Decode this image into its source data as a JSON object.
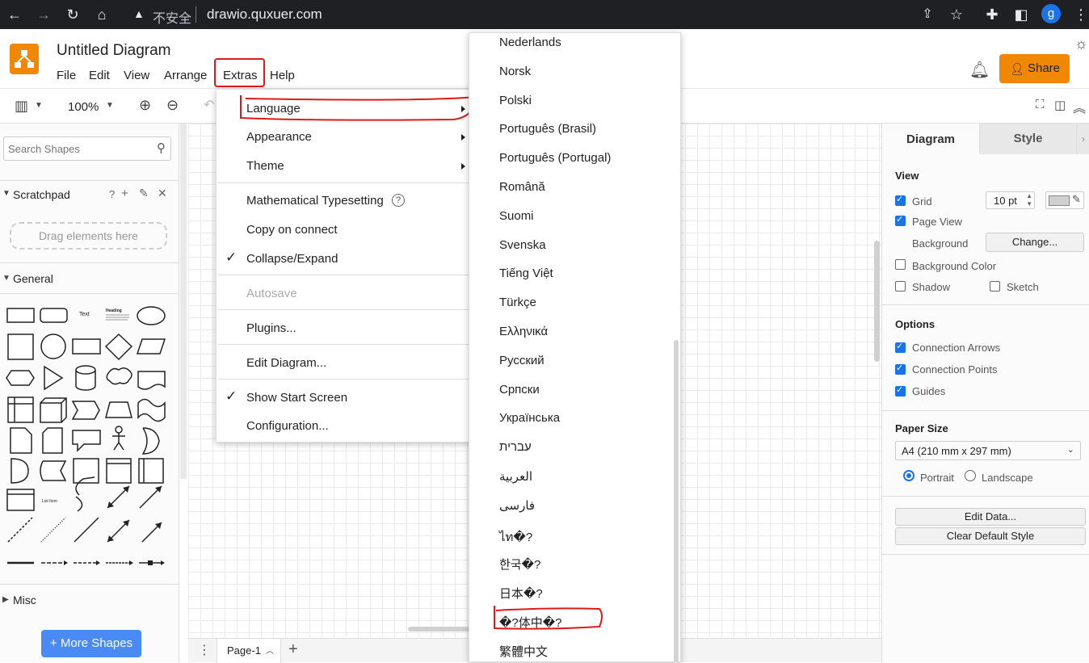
{
  "browser": {
    "security_label": "不安全",
    "url": "drawio.quxuer.com",
    "profile_initial": "g"
  },
  "app": {
    "title": "Untitled Diagram",
    "menus": [
      "File",
      "Edit",
      "View",
      "Arrange",
      "Extras",
      "Help"
    ],
    "share_label": "Share",
    "brand_color": "#f08705"
  },
  "toolbar": {
    "zoom": "100%"
  },
  "left_panel": {
    "search_placeholder": "Search Shapes",
    "scratchpad_title": "Scratchpad",
    "scratchpad_help": "?",
    "drag_hint": "Drag elements here",
    "general_title": "General",
    "text_shape_label": "Text",
    "heading_shape_label": "Heading",
    "list_item_label": "List Item",
    "misc_title": "Misc",
    "more_shapes_label": "More Shapes"
  },
  "bottom_bar": {
    "page_tab": "Page-1"
  },
  "right_panel": {
    "tabs": [
      "Diagram",
      "Style"
    ],
    "view_title": "View",
    "grid_label": "Grid",
    "grid_size": "10 pt",
    "page_view_label": "Page View",
    "background_label": "Background",
    "change_button": "Change...",
    "background_color_label": "Background Color",
    "shadow_label": "Shadow",
    "sketch_label": "Sketch",
    "options_title": "Options",
    "connection_arrows": "Connection Arrows",
    "connection_points": "Connection Points",
    "guides": "Guides",
    "paper_size_title": "Paper Size",
    "paper_size_value": "A4 (210 mm x 297 mm)",
    "portrait_label": "Portrait",
    "landscape_label": "Landscape",
    "edit_data_button": "Edit Data...",
    "clear_style_button": "Clear Default Style"
  },
  "extras_menu": {
    "items": {
      "language": "Language",
      "appearance": "Appearance",
      "theme": "Theme",
      "math": "Mathematical Typesetting",
      "copy_on_connect": "Copy on connect",
      "collapse_expand": "Collapse/Expand",
      "autosave": "Autosave",
      "plugins": "Plugins...",
      "edit_diagram": "Edit Diagram...",
      "show_start_screen": "Show Start Screen",
      "configuration": "Configuration..."
    }
  },
  "language_menu": {
    "items": [
      "Nederlands",
      "Norsk",
      "Polski",
      "Português (Brasil)",
      "Português (Portugal)",
      "Română",
      "Suomi",
      "Svenska",
      "Tiếng Việt",
      "Türkçe",
      "Ελληνικά",
      "Русский",
      "Српски",
      "Українська",
      "עברית",
      "العربية",
      "فارسی",
      "ไท�?",
      "한국�?",
      "日本�?",
      "�?体中�?",
      "繁體中文"
    ]
  }
}
